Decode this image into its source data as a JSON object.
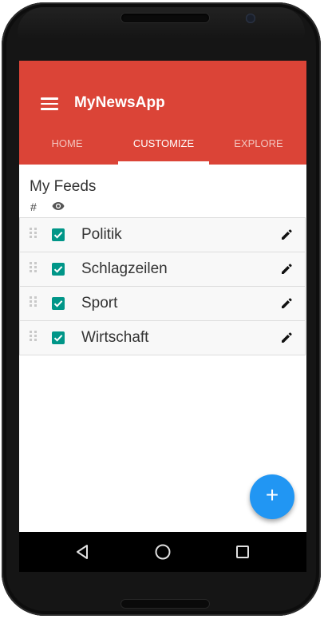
{
  "app": {
    "title": "MyNewsApp",
    "accent_color": "#DB4437",
    "fab_color": "#2196F3",
    "checkbox_color": "#009688"
  },
  "tabs": [
    {
      "label": "HOME",
      "active": false
    },
    {
      "label": "CUSTOMIZE",
      "active": true
    },
    {
      "label": "EXPLORE",
      "active": false
    }
  ],
  "feeds": {
    "title": "My Feeds",
    "col_order_label": "#",
    "col_visible_icon": "eye-icon",
    "items": [
      {
        "label": "Politik",
        "checked": true
      },
      {
        "label": "Schlagzeilen",
        "checked": true
      },
      {
        "label": "Sport",
        "checked": true
      },
      {
        "label": "Wirtschaft",
        "checked": true
      }
    ]
  },
  "fab": {
    "label": "+",
    "icon": "plus-icon"
  },
  "navbar": {
    "icons": [
      "back-icon",
      "home-icon",
      "recents-icon"
    ]
  }
}
